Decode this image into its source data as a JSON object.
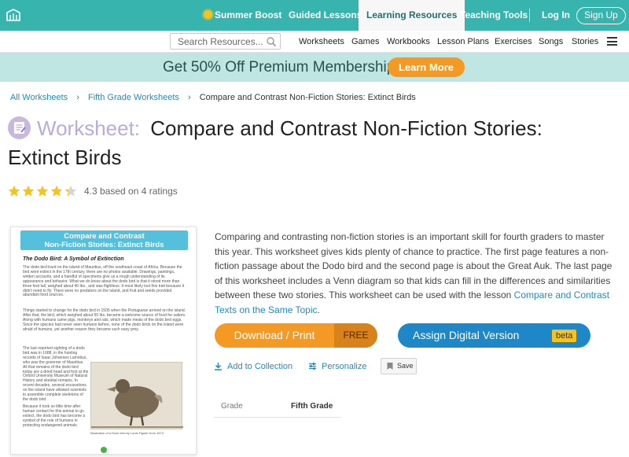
{
  "topnav": {
    "items": [
      {
        "label": "Summer Boost"
      },
      {
        "label": "Guided Lessons"
      },
      {
        "label": "Learning Resources"
      },
      {
        "label": "Teaching Tools"
      }
    ],
    "login": "Log In",
    "signup": "Sign Up"
  },
  "subnav": {
    "search_placeholder": "Search Resources...",
    "items": [
      "Worksheets",
      "Games",
      "Workbooks",
      "Lesson Plans",
      "Exercises",
      "Songs",
      "Stories"
    ]
  },
  "promo": {
    "text": "Get 50% Off Premium Membership",
    "cta": "Learn More"
  },
  "breadcrumb": {
    "items": [
      "All Worksheets",
      "Fifth Grade Worksheets"
    ],
    "current": "Compare and Contrast Non-Fiction Stories: Extinct Birds"
  },
  "title": {
    "kind": "Worksheet:",
    "line1": "Compare and Contrast Non-Fiction Stories:",
    "line2": "Extinct Birds"
  },
  "rating": {
    "value": 4.3,
    "max": 5,
    "text": "4.3 based on 4 ratings"
  },
  "preview": {
    "header_line1": "Compare and Contrast",
    "header_line2": "Non-Fiction Stories: Extinct Birds",
    "subtitle": "The Dodo Bird: A Symbol of Extinction",
    "para1": "The dodo bird lived on the island of Mauritius, off the southeast coast of Africa. Because the bird went extinct in the 17th century, there are no photos available. Drawings, paintings, written accounts, and a handful of specimens give us a rough understanding of its appearance and behavior. What we do know about the dodo bird is that it stood more than three feet tall, weighed about 40 lbs., and was flightless. It most likely lost this trait because it didn't need to fly: There were no predators on the island, and fruit and seeds provided abundant food sources.",
    "para2": "Things started to change for the dodo bird in 1505 when the Portuguese arrived on the island. After that, the bird, which weighed about 50 lbs. became a welcome source of food for sailors. Along with humans came pigs, monkeys and rats, which made meals of the dodo bird eggs. Since the species had never seen humans before, none of the dodo birds on the island were afraid of humans, yet another reason they became such easy prey.",
    "para3": "The last reported sighting of a dodo bird was in 1688, in the hunting records of Isaac Johannes Lamotius, who was the governor of Mauritius. All that remains of the dodo bird today are a dried head and foot at the Oxford University Museum of Natural History and skeletal remains. In recent decades, several excavations on the island have allowed scientists to assemble complete skeletons of the dodo bird.",
    "para4": "Because it took so little time after human contact for this animal to go extinct, the dodo bird has become a symbol of the role of humans in protecting endangered animals.",
    "caption": "Illustration of a Dodo bird by Louis Figuier from 1873"
  },
  "description": {
    "text": "Comparing and contrasting non-fiction stories is an important skill for fourth graders to master this year. This worksheet gives kids plenty of chance to practice. The first page features a non-fiction passage about the Dodo bird and the second page is about the Great Auk. The last page of this worksheet includes a Venn diagram so that kids can fill in the differences and similarities between these two stories. This worksheet can be used with the lesson ",
    "link": "Compare and Contrast Texts on the Same Topic",
    "end": "."
  },
  "actions": {
    "download": "Download / Print",
    "free": "FREE",
    "digital": "Assign Digital Version",
    "beta": "beta",
    "add_to_collection": "Add to Collection",
    "personalize": "Personalize",
    "save": "Save"
  },
  "details": {
    "grade_label": "Grade",
    "grade_value": "Fifth Grade"
  },
  "colors": {
    "brand_teal": "#36b4ad",
    "promo_bg": "#bfe6e3",
    "orange": "#f49a24",
    "blue": "#1e87c7",
    "star": "#f7c31b",
    "link": "#1f8bc7"
  }
}
